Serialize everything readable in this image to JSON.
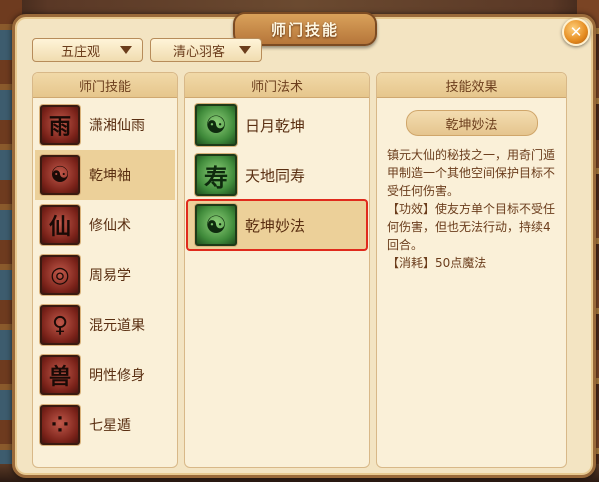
{
  "window": {
    "title": "师门技能",
    "close_label": "✕"
  },
  "filters": {
    "sect": "五庄观",
    "type": "清心羽客"
  },
  "left_panel": {
    "header": "师门技能",
    "items": [
      {
        "label": "潇湘仙雨",
        "icon": "rain-scroll-icon",
        "glyph": "雨"
      },
      {
        "label": "乾坤袖",
        "icon": "sleeve-yinyang-icon",
        "glyph": "☯"
      },
      {
        "label": "修仙术",
        "icon": "figure-icon",
        "glyph": "仙"
      },
      {
        "label": "周易学",
        "icon": "bagua-icon",
        "glyph": "◎"
      },
      {
        "label": "混元道果",
        "icon": "dao-fruit-icon",
        "glyph": "♀"
      },
      {
        "label": "明性修身",
        "icon": "beast-icon",
        "glyph": "兽"
      },
      {
        "label": "七星遁",
        "icon": "seven-stars-icon",
        "glyph": "⁘"
      }
    ],
    "selected_index": 1
  },
  "middle_panel": {
    "header": "师门法术",
    "items": [
      {
        "label": "日月乾坤",
        "icon": "sun-moon-icon",
        "glyph": "☯"
      },
      {
        "label": "天地同寿",
        "icon": "figures-icon",
        "glyph": "寿"
      },
      {
        "label": "乾坤妙法",
        "icon": "yinyang-icon",
        "glyph": "☯"
      }
    ],
    "selected_index": 2
  },
  "right_panel": {
    "header": "技能效果",
    "skill_name": "乾坤妙法",
    "description": "镇元大仙的秘技之一，用奇门遁甲制造一个其他空间保护目标不受任何伤害。",
    "effect": "【功效】使友方单个目标不受任何伤害，但也无法行动，持续4回合。",
    "cost": "【消耗】50点魔法"
  },
  "colors": {
    "accent_highlight": "#e02a1c",
    "selected_row": "#ecd099",
    "text_brown": "#6b3d1c"
  }
}
